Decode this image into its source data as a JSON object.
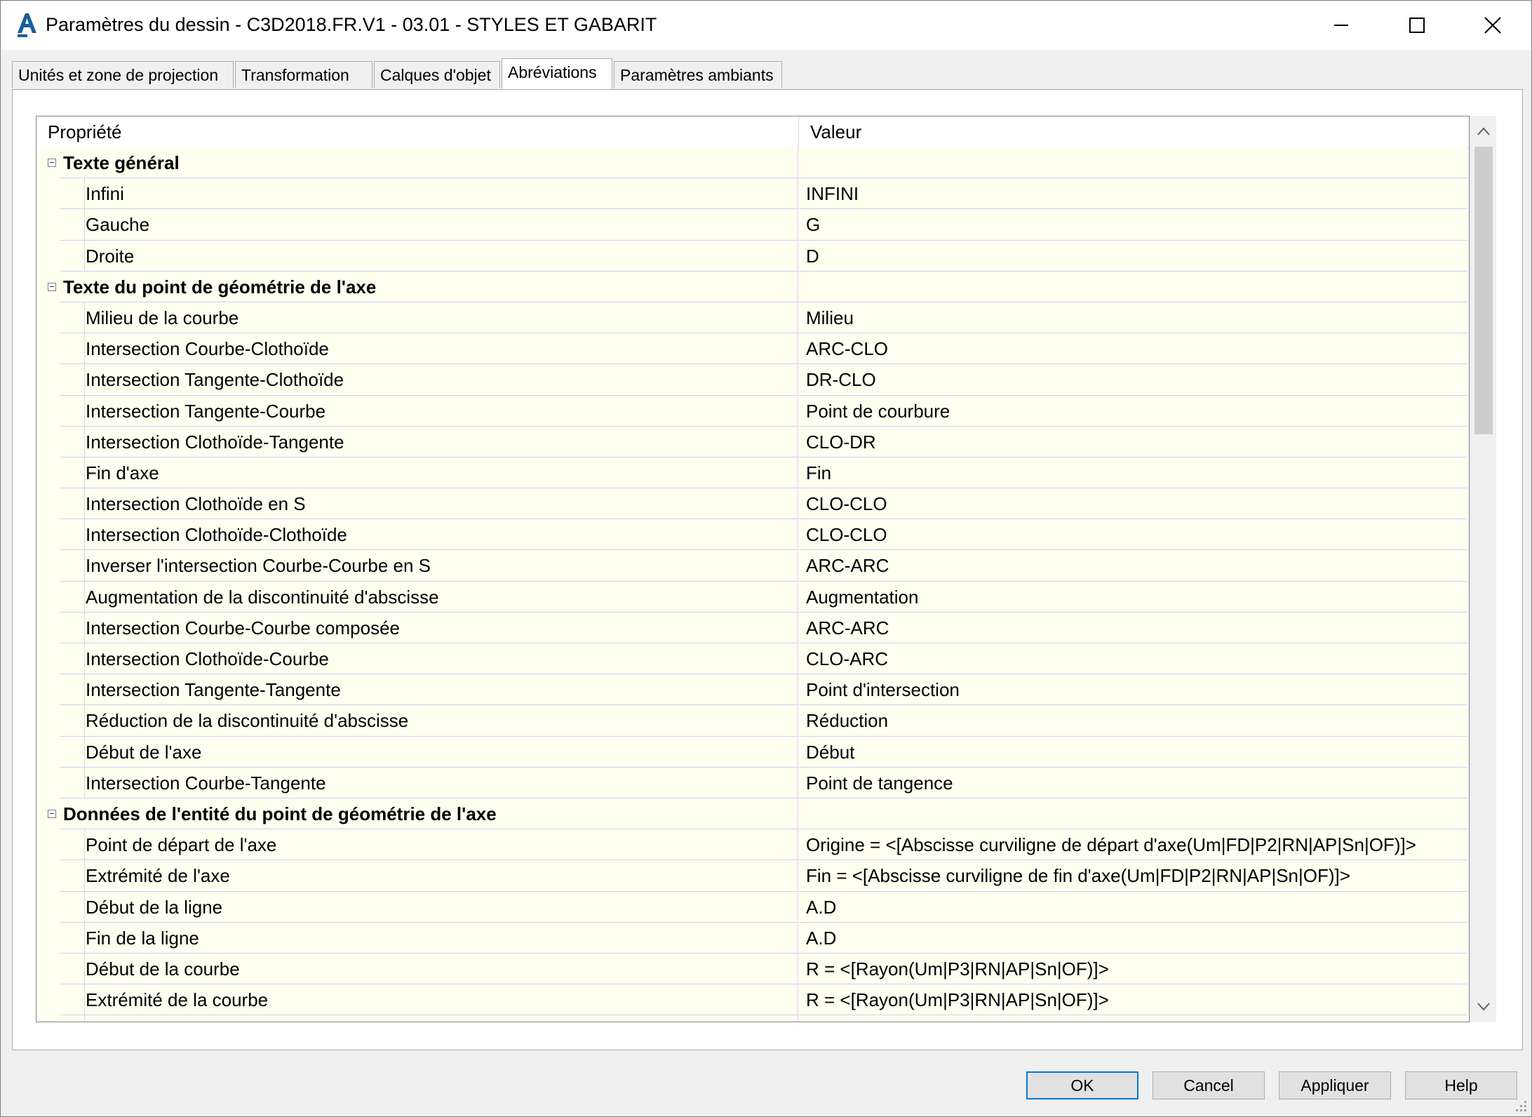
{
  "window": {
    "title": "Paramètres du dessin - C3D2018.FR.V1 - 03.01 - STYLES ET GABARIT",
    "app_icon": "autocad-a-icon",
    "controls": [
      "minimize-icon",
      "maximize-icon",
      "close-icon"
    ]
  },
  "tabs": [
    {
      "label": "Unités et zone de projection",
      "active": false
    },
    {
      "label": "Transformation",
      "active": false
    },
    {
      "label": "Calques d'objet",
      "active": false
    },
    {
      "label": "Abréviations",
      "active": true
    },
    {
      "label": "Paramètres ambiants",
      "active": false
    }
  ],
  "grid": {
    "columns": {
      "property": "Propriété",
      "value": "Valeur"
    },
    "rows": [
      {
        "type": "category",
        "property": "Texte général",
        "value": ""
      },
      {
        "type": "item",
        "property": "Infini",
        "value": "INFINI"
      },
      {
        "type": "item",
        "property": "Gauche",
        "value": "G"
      },
      {
        "type": "item",
        "property": "Droite",
        "value": "D"
      },
      {
        "type": "category",
        "property": "Texte du point de géométrie de l'axe",
        "value": ""
      },
      {
        "type": "item",
        "property": "Milieu de la courbe",
        "value": "Milieu"
      },
      {
        "type": "item",
        "property": "Intersection Courbe-Clothoïde",
        "value": "ARC-CLO"
      },
      {
        "type": "item",
        "property": "Intersection Tangente-Clothoïde",
        "value": "DR-CLO"
      },
      {
        "type": "item",
        "property": "Intersection Tangente-Courbe",
        "value": "Point de courbure"
      },
      {
        "type": "item",
        "property": "Intersection Clothoïde-Tangente",
        "value": "CLO-DR"
      },
      {
        "type": "item",
        "property": "Fin d'axe",
        "value": "Fin"
      },
      {
        "type": "item",
        "property": "Intersection Clothoïde en S",
        "value": "CLO-CLO"
      },
      {
        "type": "item",
        "property": "Intersection Clothoïde-Clothoïde",
        "value": "CLO-CLO"
      },
      {
        "type": "item",
        "property": "Inverser l'intersection Courbe-Courbe en S",
        "value": "ARC-ARC"
      },
      {
        "type": "item",
        "property": "Augmentation de la discontinuité d'abscisse",
        "value": "Augmentation"
      },
      {
        "type": "item",
        "property": "Intersection Courbe-Courbe composée",
        "value": "ARC-ARC"
      },
      {
        "type": "item",
        "property": "Intersection Clothoïde-Courbe",
        "value": "CLO-ARC"
      },
      {
        "type": "item",
        "property": "Intersection Tangente-Tangente",
        "value": "Point d'intersection"
      },
      {
        "type": "item",
        "property": "Réduction de la discontinuité d'abscisse",
        "value": "Réduction"
      },
      {
        "type": "item",
        "property": "Début de l'axe",
        "value": "Début"
      },
      {
        "type": "item",
        "property": "Intersection Courbe-Tangente",
        "value": "Point de tangence"
      },
      {
        "type": "category",
        "property": "Données de l'entité du point de géométrie de l'axe",
        "value": ""
      },
      {
        "type": "item",
        "property": "Point de départ de l'axe",
        "value": "Origine = <[Abscisse curviligne de départ d'axe(Um|FD|P2|RN|AP|Sn|OF)]>"
      },
      {
        "type": "item",
        "property": "Extrémité de l'axe",
        "value": "Fin = <[Abscisse curviligne de fin d'axe(Um|FD|P2|RN|AP|Sn|OF)]>"
      },
      {
        "type": "item",
        "property": "Début de la ligne",
        "value": "A.D"
      },
      {
        "type": "item",
        "property": "Fin de la ligne",
        "value": "A.D"
      },
      {
        "type": "item",
        "property": "Début de la courbe",
        "value": "R = <[Rayon(Um|P3|RN|AP|Sn|OF)]>"
      },
      {
        "type": "item",
        "property": "Extrémité de la courbe",
        "value": "R = <[Rayon(Um|P3|RN|AP|Sn|OF)]>"
      },
      {
        "type": "item",
        "property": "",
        "value": ""
      }
    ]
  },
  "buttons": {
    "ok": "OK",
    "cancel": "Cancel",
    "apply": "Appliquer",
    "help": "Help"
  },
  "colors": {
    "row_bg": "#fffff0",
    "accent": "#0078d7",
    "autocad_blue": "#1b5e9a"
  }
}
